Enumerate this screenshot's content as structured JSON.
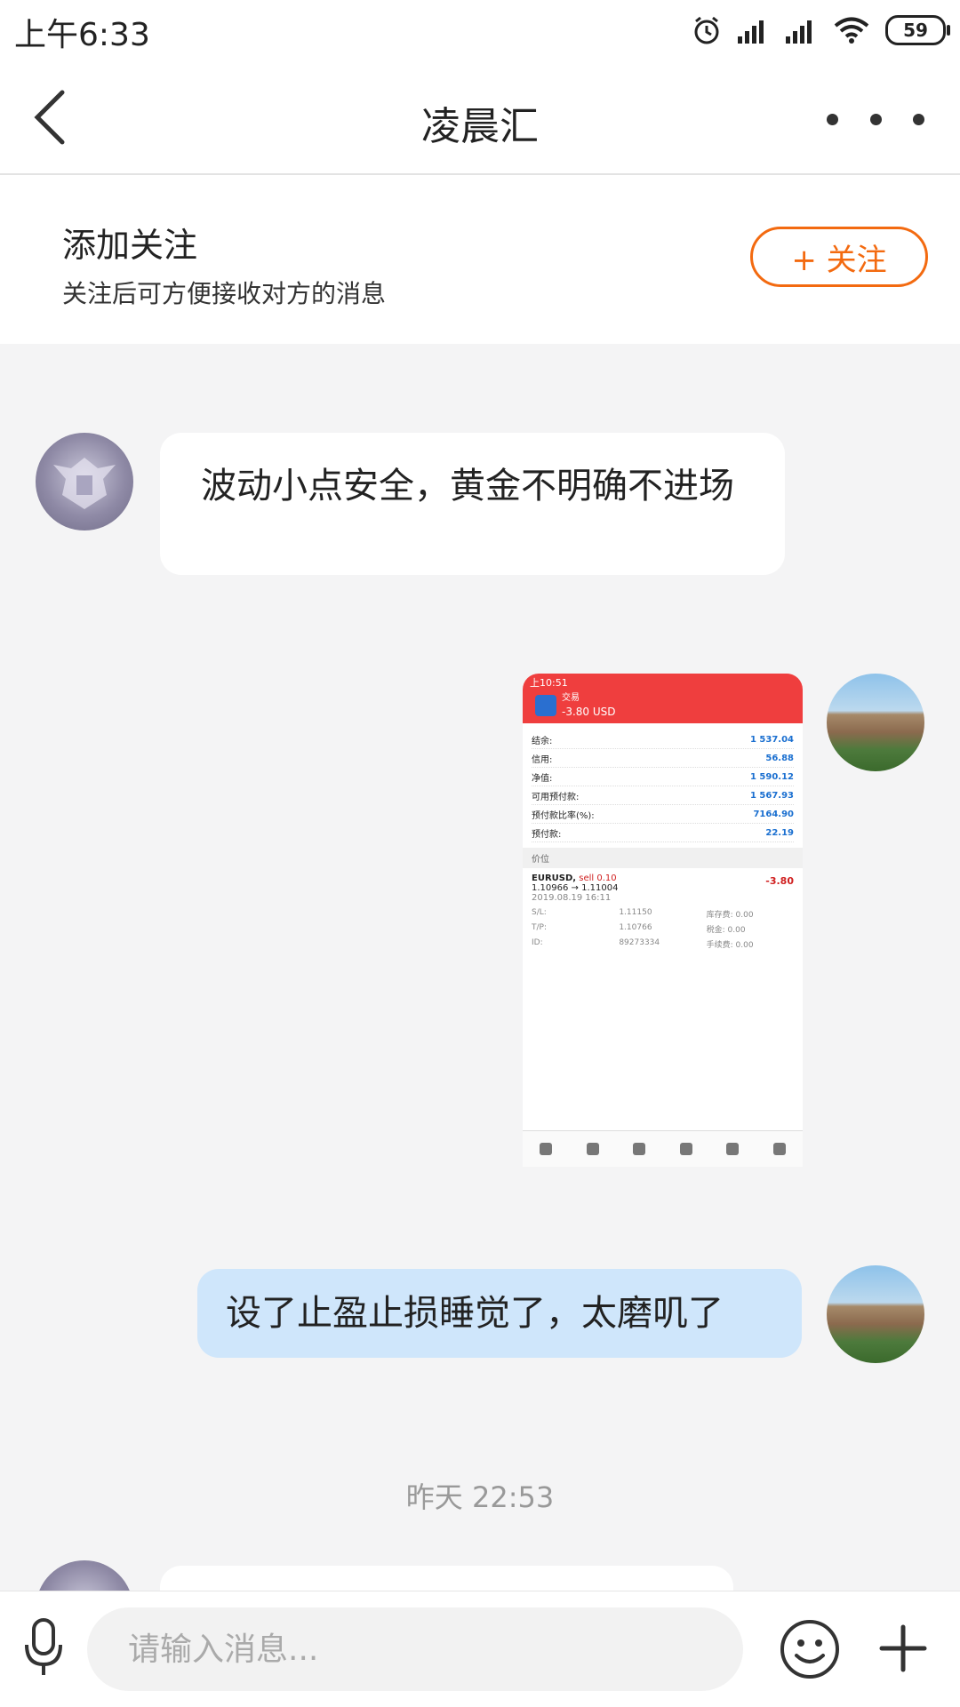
{
  "status_bar": {
    "time": "上午6:33",
    "battery": "59"
  },
  "nav": {
    "title": "凌晨汇"
  },
  "follow_banner": {
    "title": "添加关注",
    "subtitle": "关注后可方便接收对方的消息",
    "button_label": "+ 关注"
  },
  "messages": [
    {
      "side": "left",
      "type": "text",
      "text": "波动小点安全，黄金不明确不进场"
    },
    {
      "side": "right",
      "type": "image",
      "image": {
        "status_time": "上10:51",
        "header_label": "交易",
        "header_amount": "-3.80 USD",
        "rows": [
          {
            "label": "结余:",
            "value": "1 537.04"
          },
          {
            "label": "信用:",
            "value": "56.88"
          },
          {
            "label": "净值:",
            "value": "1 590.12"
          },
          {
            "label": "可用预付款:",
            "value": "1 567.93"
          },
          {
            "label": "预付款比率(%):",
            "value": "7164.90"
          },
          {
            "label": "预付款:",
            "value": "22.19"
          }
        ],
        "section_label": "价位",
        "position": {
          "symbol": "EURUSD,",
          "side": "sell 0.10",
          "prices": "1.10966 → 1.11004",
          "date": "2019.08.19 16:11",
          "profit": "-3.80",
          "details": [
            "S/L:",
            "1.11150",
            "库存费:  0.00",
            "T/P:",
            "1.10766",
            "税金:  0.00",
            "ID:",
            "89273334",
            "手续费:  0.00"
          ]
        }
      }
    },
    {
      "side": "right",
      "type": "text",
      "text": "设了止盈止损睡觉了，太磨叽了"
    }
  ],
  "timestamp": "昨天 22:53",
  "input": {
    "placeholder": "请输入消息..."
  },
  "icons": {
    "back": "back-arrow-icon",
    "more": "more-dots-icon",
    "mic": "microphone-icon",
    "emoji": "emoji-icon",
    "plus": "plus-icon"
  },
  "colors": {
    "accent": "#f36a10",
    "bubble_self": "#cfe6fb",
    "background": "#f4f4f5"
  }
}
